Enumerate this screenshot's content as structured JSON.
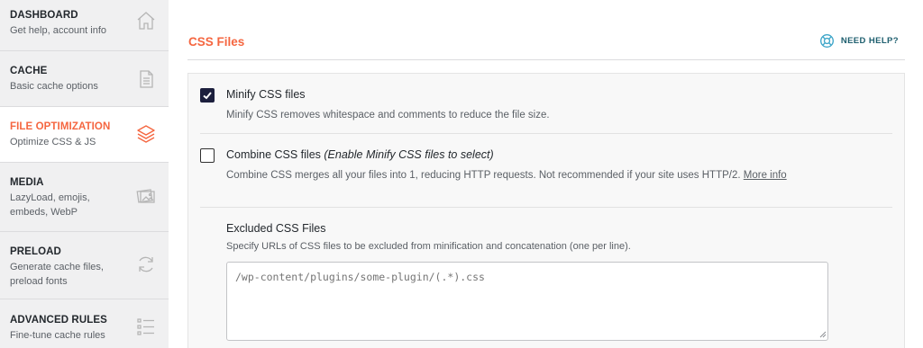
{
  "sidebar": {
    "items": [
      {
        "title": "DASHBOARD",
        "subtitle": "Get help, account info",
        "icon": "home-icon",
        "active": false
      },
      {
        "title": "CACHE",
        "subtitle": "Basic cache options",
        "icon": "document-icon",
        "active": false
      },
      {
        "title": "FILE OPTIMIZATION",
        "subtitle": "Optimize CSS & JS",
        "icon": "layers-icon",
        "active": true
      },
      {
        "title": "MEDIA",
        "subtitle": "LazyLoad, emojis, embeds, WebP",
        "icon": "images-icon",
        "active": false
      },
      {
        "title": "PRELOAD",
        "subtitle": "Generate cache files, preload fonts",
        "icon": "refresh-icon",
        "active": false
      },
      {
        "title": "ADVANCED RULES",
        "subtitle": "Fine-tune cache rules",
        "icon": "list-icon",
        "active": false
      }
    ]
  },
  "main": {
    "title": "CSS Files",
    "help_label": "NEED HELP?",
    "minify": {
      "label": "Minify CSS files",
      "description": "Minify CSS removes whitespace and comments to reduce the file size.",
      "checked": true
    },
    "combine": {
      "label": "Combine CSS files",
      "label_note": "(Enable Minify CSS files to select)",
      "description": "Combine CSS merges all your files into 1, reducing HTTP requests. Not recommended if your site uses HTTP/2.",
      "more_info": "More info",
      "checked": false
    },
    "excluded": {
      "label": "Excluded CSS Files",
      "description": "Specify URLs of CSS files to be excluded from minification and concatenation (one per line).",
      "placeholder": "/wp-content/plugins/some-plugin/(.*).css"
    }
  },
  "colors": {
    "accent": "#f56640",
    "help": "#1d5e6e",
    "checkbox_checked": "#1c1f3d"
  }
}
